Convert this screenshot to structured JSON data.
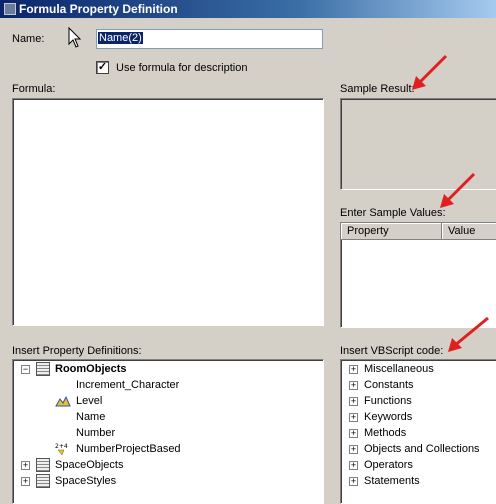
{
  "window": {
    "title": "Formula Property Definition"
  },
  "name_field": {
    "label": "Name:",
    "value": "Name(2)"
  },
  "description_checkbox": {
    "label": "Use formula for description",
    "checked": true
  },
  "formula": {
    "label": "Formula:"
  },
  "sample_result": {
    "label": "Sample Result:"
  },
  "sample_values": {
    "label": "Enter Sample Values:",
    "columns": [
      "Property",
      "Value"
    ]
  },
  "property_definitions": {
    "label": "Insert Property Definitions:",
    "items": [
      {
        "label": "RoomObjects",
        "expander": "−",
        "icon": "object-set-icon"
      },
      {
        "label": "Increment_Character",
        "icon": "blank-icon"
      },
      {
        "label": "Level",
        "icon": "level-icon"
      },
      {
        "label": "Name",
        "icon": "blank-icon"
      },
      {
        "label": "Number",
        "icon": "blank-icon"
      },
      {
        "label": "NumberProjectBased",
        "icon": "numbering-icon"
      },
      {
        "label": "SpaceObjects",
        "expander": "+",
        "icon": "object-set-icon"
      },
      {
        "label": "SpaceStyles",
        "expander": "+",
        "icon": "object-set-icon"
      }
    ]
  },
  "vbscript": {
    "label": "Insert VBScript code:",
    "items": [
      {
        "label": "Miscellaneous",
        "expander": "+"
      },
      {
        "label": "Constants",
        "expander": "+"
      },
      {
        "label": "Functions",
        "expander": "+"
      },
      {
        "label": "Keywords",
        "expander": "+"
      },
      {
        "label": "Methods",
        "expander": "+"
      },
      {
        "label": "Objects and Collections",
        "expander": "+"
      },
      {
        "label": "Operators",
        "expander": "+"
      },
      {
        "label": "Statements",
        "expander": "+"
      }
    ]
  },
  "colors": {
    "dialog_bg": "#d4d0c8",
    "title_bar": "#0a246a",
    "selection": "#0a246a",
    "annotation_arrow": "#e02020"
  }
}
